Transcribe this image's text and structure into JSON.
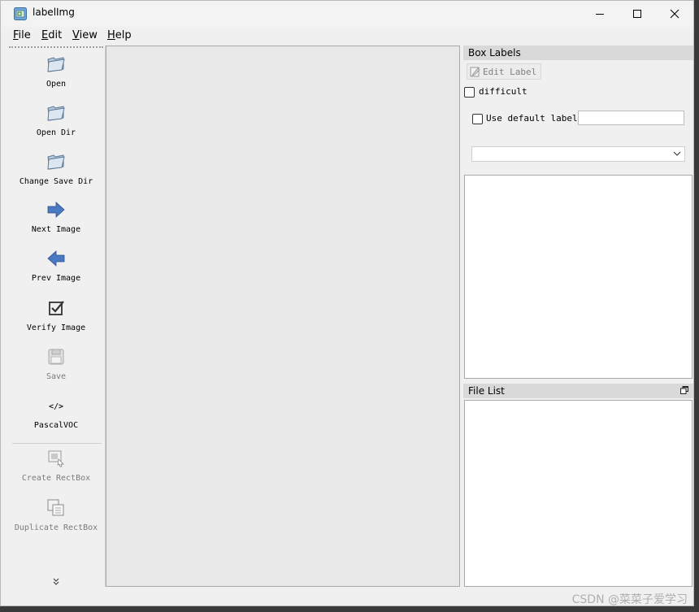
{
  "window": {
    "title": "labelImg"
  },
  "menu": [
    "File",
    "Edit",
    "View",
    "Help"
  ],
  "toolbar": {
    "tools": [
      {
        "name": "open",
        "label": "Open",
        "icon": "folder-icon",
        "enabled": true
      },
      {
        "name": "open-dir",
        "label": "Open Dir",
        "icon": "folder-icon",
        "enabled": true
      },
      {
        "name": "change-save-dir",
        "label": "Change Save Dir",
        "icon": "folder-icon",
        "enabled": true
      },
      {
        "name": "next-image",
        "label": "Next Image",
        "icon": "arrow-right-icon",
        "enabled": true
      },
      {
        "name": "prev-image",
        "label": "Prev Image",
        "icon": "arrow-left-icon",
        "enabled": true
      },
      {
        "name": "verify-image",
        "label": "Verify Image",
        "icon": "checkbox-icon",
        "enabled": true
      },
      {
        "name": "save",
        "label": "Save",
        "icon": "floppy-icon",
        "enabled": false
      },
      {
        "name": "format",
        "label": "PascalVOC",
        "icon": "code-icon",
        "enabled": true
      },
      {
        "name": "create-rectbox",
        "label": "Create RectBox",
        "icon": "rectbox-icon",
        "enabled": false
      },
      {
        "name": "duplicate-rectbox",
        "label": "Duplicate RectBox",
        "icon": "duplicate-icon",
        "enabled": false
      }
    ]
  },
  "box_labels": {
    "title": "Box Labels",
    "edit_label": "Edit Label",
    "difficult_label": "difficult",
    "difficult_checked": false,
    "use_default_label": "Use default label",
    "use_default_checked": false,
    "default_label_value": "",
    "selected_label": ""
  },
  "file_list": {
    "title": "File List"
  },
  "watermark": "CSDN @菜菜子爱学习",
  "colors": {
    "window_bg": "#f0f0f0",
    "canvas_bg": "#e8e8e8",
    "dock_title_bg": "#d9d9d9",
    "arrow_blue": "#4a78c2"
  }
}
